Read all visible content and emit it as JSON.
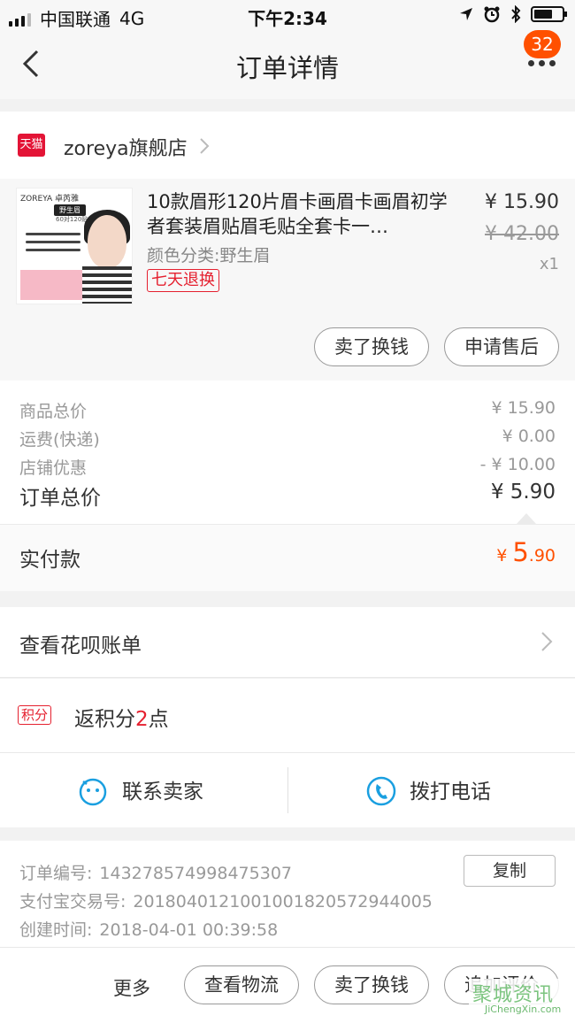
{
  "status_bar": {
    "carrier": "中国联通",
    "network": "4G",
    "time": "下午2:34"
  },
  "nav": {
    "title": "订单详情",
    "badge_count": "32"
  },
  "store": {
    "logo_text": "天猫",
    "name": "zoreya旗舰店"
  },
  "product": {
    "thumb_brand": "ZOREYA 卓芮雅",
    "thumb_tag": "野生眉",
    "thumb_sub": "60对120贴",
    "title": "10款眉形120片眉卡画眉卡画眉初学者套装眉贴眉毛贴全套卡一…",
    "sku": "颜色分类:野生眉",
    "return_badge": "七天退换",
    "price": "¥ 15.90",
    "original_price": "¥ 42.00",
    "quantity": "x1",
    "buttons": [
      "卖了换钱",
      "申请售后"
    ]
  },
  "summary": {
    "rows": [
      {
        "label": "商品总价",
        "value": "¥ 15.90"
      },
      {
        "label": "运费(快递)",
        "value": "¥ 0.00"
      },
      {
        "label": "店铺优惠",
        "value": "- ¥ 10.00"
      }
    ],
    "total_label": "订单总价",
    "total_value": "¥ 5.90",
    "paid_label": "实付款",
    "paid_currency": "¥ ",
    "paid_int": "5",
    "paid_dec": ".90"
  },
  "huabei": {
    "label": "查看花呗账单"
  },
  "points": {
    "tag": "积分",
    "prefix": "返积分",
    "num": "2",
    "suffix": "点"
  },
  "contact": {
    "seller": "联系卖家",
    "phone": "拨打电话"
  },
  "order_info": {
    "order_no_label": "订单编号:",
    "order_no": "143278574998475307",
    "alipay_label": "支付宝交易号:",
    "alipay_no": "2018040121001001820572944005",
    "created_label": "创建时间:",
    "created_time": "2018-04-01 00:39:58",
    "copy_label": "复制"
  },
  "bottom_bar": {
    "more": "更多",
    "buttons": [
      "查看物流",
      "卖了换钱",
      "追加评价"
    ]
  },
  "watermark": {
    "top": "聚城资讯",
    "bottom": "JiChengXin.com"
  },
  "colors": {
    "accent": "#ff5000",
    "tmall_red": "#e31436",
    "badge_red": "#e5202f",
    "contact_blue": "#1a9fe0"
  }
}
